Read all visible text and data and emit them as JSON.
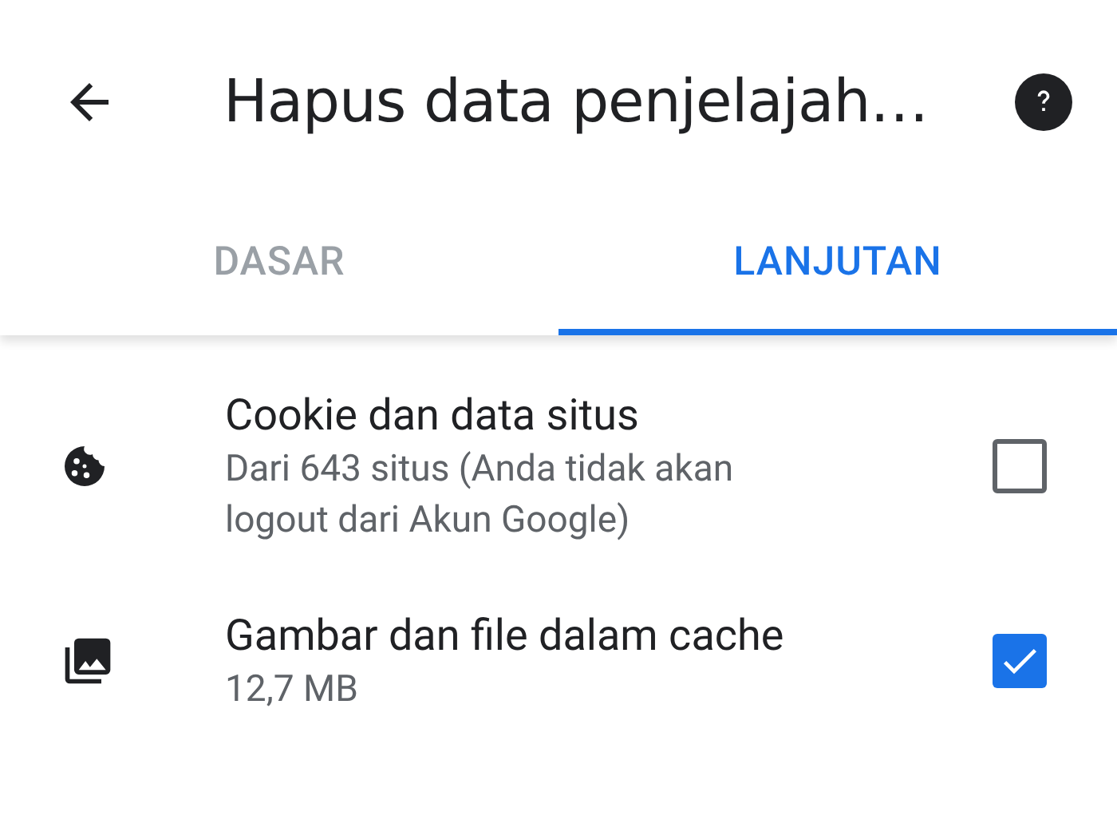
{
  "header": {
    "title": "Hapus data penjelajah…"
  },
  "tabs": [
    {
      "label": "DASAR",
      "selected": false
    },
    {
      "label": "LANJUTAN",
      "selected": true
    }
  ],
  "items": [
    {
      "kind": "cookie",
      "title": "Cookie dan data situs",
      "subtitle": "Dari 643 situs (Anda tidak akan logout dari Akun Google)",
      "checked": false
    },
    {
      "kind": "images",
      "title": "Gambar dan file dalam cache",
      "subtitle": "12,7 MB",
      "checked": true
    }
  ]
}
